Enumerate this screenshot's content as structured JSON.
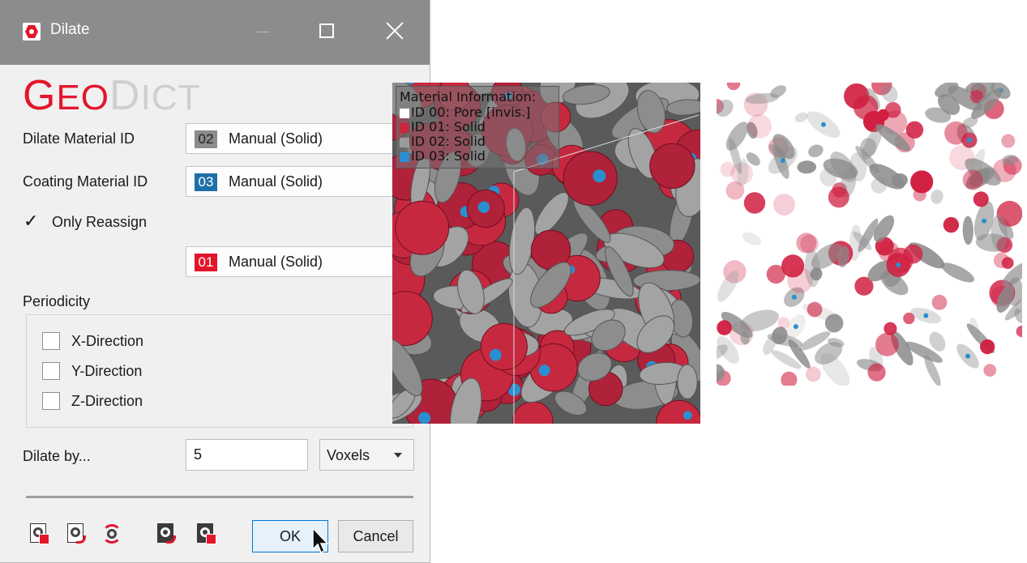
{
  "window": {
    "title": "Dilate",
    "icon": "geodict-hex-icon",
    "controls": [
      "minimize-icon",
      "maximize-icon",
      "close-icon"
    ]
  },
  "logo": {
    "part1": "G",
    "part1b": "EO",
    "part2": "D",
    "part2b": "ICT"
  },
  "form": {
    "dilate_material": {
      "label": "Dilate Material ID",
      "id": "02",
      "value": "Manual (Solid)",
      "color": "#8c8c8c"
    },
    "coating_material": {
      "label": "Coating Material ID",
      "id": "03",
      "value": "Manual (Solid)",
      "color": "#1f6fa8"
    },
    "only_reassign": {
      "label": "Only Reassign",
      "checked": true,
      "checkmark": "✓"
    },
    "reassign_material": {
      "id": "01",
      "value": "Manual (Solid)",
      "color": "#e3152b"
    },
    "periodicity": {
      "label": "Periodicity",
      "options": [
        {
          "label": "X-Direction",
          "checked": false
        },
        {
          "label": "Y-Direction",
          "checked": false
        },
        {
          "label": "Z-Direction",
          "checked": false
        }
      ]
    },
    "dilate_by": {
      "label": "Dilate by...",
      "value": "5",
      "unit": "Voxels"
    }
  },
  "toolbar": {
    "icons": [
      "load-settings-icon",
      "save-settings-icon",
      "reset-icon",
      "run-macro-icon",
      "record-macro-icon"
    ],
    "ok_label": "OK",
    "cancel_label": "Cancel"
  },
  "view3d": {
    "legend": {
      "title": "Material Information:",
      "items": [
        {
          "text": "ID 00: Pore [invis.]",
          "color": "#ffffff"
        },
        {
          "text": "ID 01: Solid",
          "color": "#c8283c"
        },
        {
          "text": "ID 02: Solid",
          "color": "#9a9a9a"
        },
        {
          "text": "ID 03: Solid",
          "color": "#2a8fd0"
        }
      ]
    }
  },
  "colors": {
    "red": "#c01f38",
    "gray": "#7f7f7f",
    "blue": "#2a8fd0",
    "accent": "#e3152b"
  }
}
